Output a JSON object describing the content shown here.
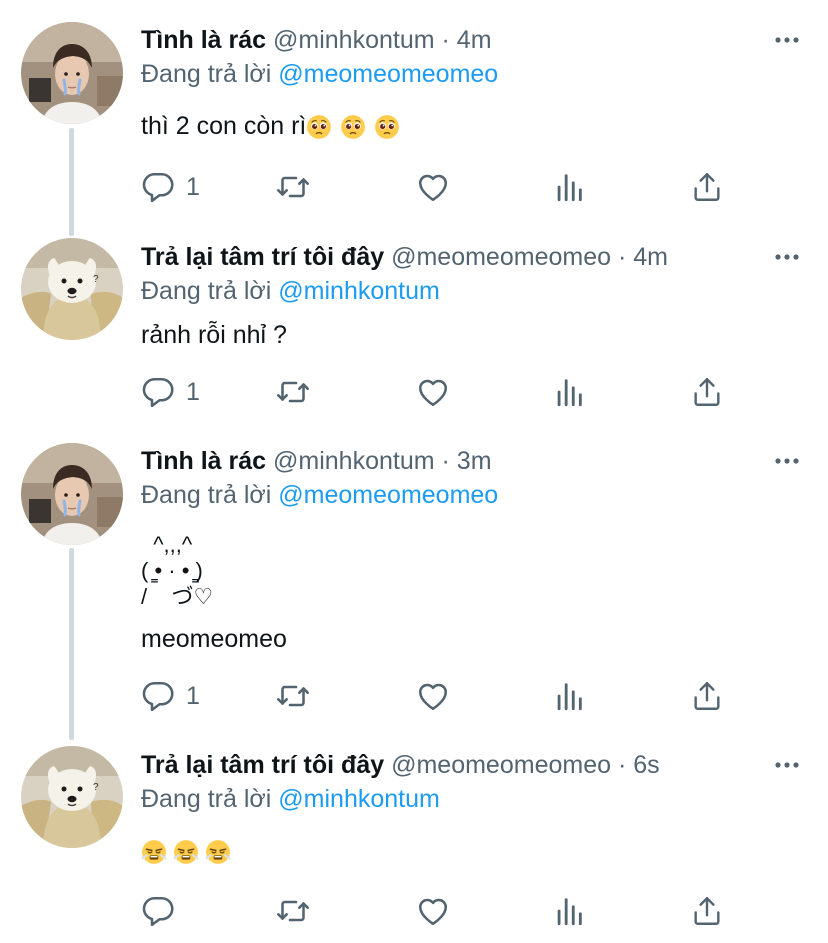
{
  "tweets": [
    {
      "author_name": "Tình là rác",
      "handle": "@minhkontum",
      "separator": "·",
      "time": "4m",
      "reply_prefix": "Đang trả lời",
      "reply_mention": "@meomeomeomeo",
      "text": "thì 2 con còn rì",
      "emoji_trail": [
        "pleading-face",
        "pleading-face",
        "pleading-face"
      ],
      "avatar_icon": "person-avatar",
      "reply_count": "1"
    },
    {
      "author_name": "Trả lại tâm trí tôi đây",
      "handle": "@meomeomeomeo",
      "separator": "·",
      "time": "4m",
      "reply_prefix": "Đang trả lời",
      "reply_mention": "@minhkontum",
      "text": "rảnh rỗi nhỉ ?",
      "avatar_icon": "dog-avatar",
      "reply_count": "1"
    },
    {
      "author_name": "Tình là rác",
      "handle": "@minhkontum",
      "separator": "·",
      "time": "3m",
      "reply_prefix": "Đang trả lời",
      "reply_mention": "@meomeomeomeo",
      "kaomoji_lines": [
        "  ^,,,^",
        "( ̳• · • ̳)",
        "/    づ♡"
      ],
      "text": "meomeomeo",
      "avatar_icon": "person-avatar",
      "reply_count": "1"
    },
    {
      "author_name": "Trả lại tâm trí tôi đây",
      "handle": "@meomeomeomeo",
      "separator": "·",
      "time": "6s",
      "reply_prefix": "Đang trả lời",
      "reply_mention": "@minhkontum",
      "emoji_only": [
        "triumph-face",
        "triumph-face",
        "triumph-face"
      ],
      "avatar_icon": "dog-avatar",
      "reply_count": ""
    }
  ],
  "icons": {
    "reply": "reply-icon",
    "retweet": "retweet-icon",
    "like": "heart-icon",
    "analytics": "analytics-icon",
    "share": "share-icon",
    "more": "more-icon"
  },
  "colors": {
    "text": "#0f1419",
    "secondary": "#536471",
    "mention": "#1d9bf0",
    "thread_line": "#cfd9de"
  }
}
